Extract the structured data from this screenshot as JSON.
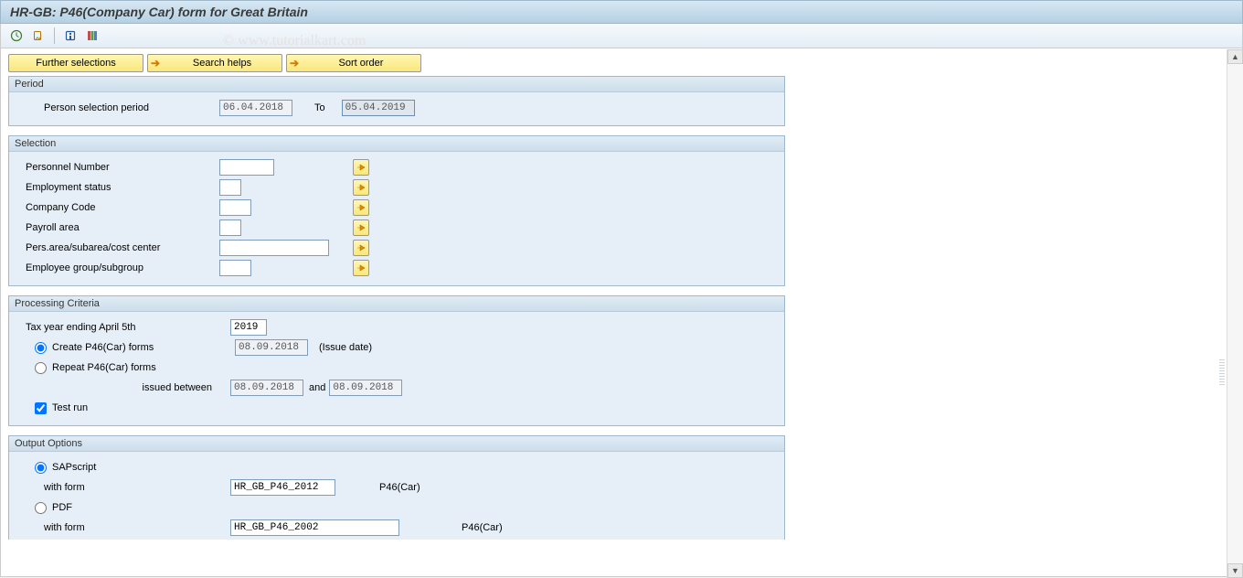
{
  "title": "HR-GB: P46(Company Car) form for Great Britain",
  "watermark": "© www.tutorialkart.com",
  "optionButtons": {
    "further": "Further selections",
    "searchHelps": "Search helps",
    "sortOrder": "Sort order"
  },
  "period": {
    "heading": "Period",
    "personSelectionLabel": "Person selection period",
    "from": "06.04.2018",
    "toLabel": "To",
    "to": "05.04.2019"
  },
  "selection": {
    "heading": "Selection",
    "personnelNumber": {
      "label": "Personnel Number",
      "value": ""
    },
    "employmentStatus": {
      "label": "Employment status",
      "value": ""
    },
    "companyCode": {
      "label": "Company Code",
      "value": ""
    },
    "payrollArea": {
      "label": "Payroll area",
      "value": ""
    },
    "persArea": {
      "label": "Pers.area/subarea/cost center",
      "value": ""
    },
    "employeeGroup": {
      "label": "Employee group/subgroup",
      "value": ""
    }
  },
  "processing": {
    "heading": "Processing Criteria",
    "taxYearLabel": "Tax year ending April 5th",
    "taxYear": "2019",
    "createLabel": "Create P46(Car) forms",
    "createDate": "08.09.2018",
    "issueDateLabel": "(Issue date)",
    "repeatLabel": "Repeat P46(Car) forms",
    "issuedBetweenLabel": "issued  between",
    "issuedFrom": "08.09.2018",
    "andLabel": "and",
    "issuedTo": "08.09.2018",
    "testRunLabel": "Test run"
  },
  "output": {
    "heading": "Output Options",
    "sapscriptLabel": "SAPscript",
    "withFormLabel": "with form",
    "sapscriptForm": "HR_GB_P46_2012",
    "sapscriptDesc": "P46(Car)",
    "pdfLabel": "PDF",
    "pdfForm": "HR_GB_P46_2002",
    "pdfDesc": "P46(Car)"
  }
}
